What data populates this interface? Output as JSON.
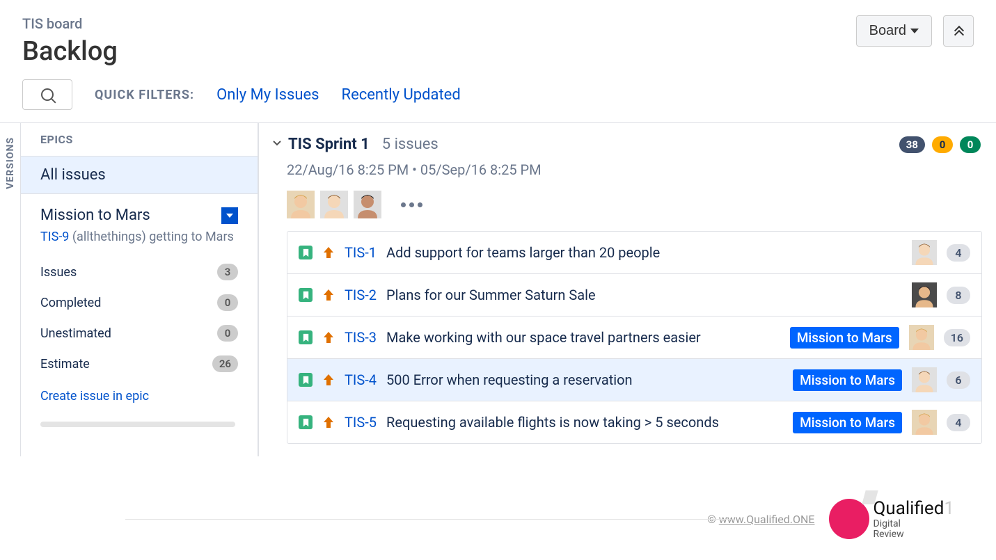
{
  "header": {
    "board_name": "TIS board",
    "page_title": "Backlog",
    "board_button": "Board"
  },
  "filters": {
    "label": "QUICK FILTERS:",
    "only_my": "Only My Issues",
    "recent": "Recently Updated"
  },
  "versions_label": "VERSIONS",
  "sidebar": {
    "epics_label": "EPICS",
    "all_issues": "All issues",
    "epic": {
      "title": "Mission to Mars",
      "key": "TIS-9",
      "rest": " (allthethings) getting to Mars",
      "stats": {
        "issues_label": "Issues",
        "issues": "3",
        "completed_label": "Completed",
        "completed": "0",
        "unestimated_label": "Unestimated",
        "unestimated": "0",
        "estimate_label": "Estimate",
        "estimate": "26"
      },
      "create_link": "Create issue in epic"
    }
  },
  "sprint": {
    "name": "TIS Sprint 1",
    "count": "5 issues",
    "dates": "22/Aug/16 8:25 PM  •  05/Sep/16 8:25 PM",
    "estimates": {
      "todo": "38",
      "progress": "0",
      "done": "0"
    },
    "assignees": [
      "user-1",
      "user-2",
      "user-3"
    ]
  },
  "issues": [
    {
      "key": "TIS-1",
      "summary": "Add support for teams larger than 20 people",
      "epic": "",
      "assignee": "user-2",
      "estimate": "4",
      "hl": false
    },
    {
      "key": "TIS-2",
      "summary": "Plans for our Summer Saturn Sale",
      "epic": "",
      "assignee": "user-4",
      "estimate": "8",
      "hl": false
    },
    {
      "key": "TIS-3",
      "summary": "Make working with our space travel partners easier",
      "epic": "Mission to Mars",
      "assignee": "user-1",
      "estimate": "16",
      "hl": false
    },
    {
      "key": "TIS-4",
      "summary": "500 Error when requesting a reservation",
      "epic": "Mission to Mars",
      "assignee": "user-2",
      "estimate": "6",
      "hl": true
    },
    {
      "key": "TIS-5",
      "summary": "Requesting available flights is now taking > 5 seconds",
      "epic": "Mission to Mars",
      "assignee": "user-1",
      "estimate": "4",
      "hl": false
    }
  ],
  "footer": {
    "copy_prefix": "© ",
    "link": "www.Qualified.ONE",
    "logo_main": "Qualified",
    "logo_1": "1",
    "logo_sub1": "Digital",
    "logo_sub2": "Review"
  },
  "avatar_colors": {
    "user-1": {
      "bg": "#E8D5B5",
      "face": "#F2C9A2",
      "hair": "#D6A24C"
    },
    "user-2": {
      "bg": "#E0E0E0",
      "face": "#F5D7B8",
      "hair": "#8B5A2B"
    },
    "user-3": {
      "bg": "#DDD",
      "face": "#C68E6E",
      "hair": "#1B1B1B"
    },
    "user-4": {
      "bg": "#4A4A4A",
      "face": "#E6B88A",
      "hair": "#2B1B1B"
    }
  }
}
